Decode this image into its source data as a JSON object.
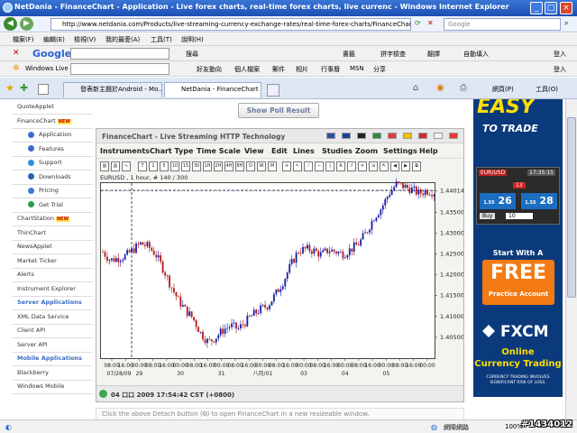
{
  "window": {
    "title": "NetDania - FinanceChart - Application - Live forex charts, real-time forex charts, live currenc - Windows Internet Explorer"
  },
  "address_bar": {
    "url": "http://www.netdania.com/Products/live-streaming-currency-exchange-rates/real-time-forex-charts/FinanceChart.aspx",
    "search_placeholder": "Google"
  },
  "menu_bar": [
    "檔案(F)",
    "編輯(E)",
    "檢視(V)",
    "我的最愛(A)",
    "工具(T)",
    "說明(H)"
  ],
  "google_bar": {
    "logo": "Google",
    "search_label": "搜尋",
    "items": [
      "書籤",
      "拼字檢查",
      "翻譯",
      "自動填入"
    ],
    "login": "登入"
  },
  "live_bar": {
    "brand": "Windows Live",
    "items": [
      "好友動向",
      "個人檔案",
      "郵件",
      "相片",
      "行事曆",
      "MSN",
      "分享"
    ],
    "login": "登入"
  },
  "tabs": [
    {
      "label": "發表新主題於Android - Mo..."
    },
    {
      "label": "NetDania - FinanceChart - ..."
    }
  ],
  "ie_toolbar": {
    "page": "網頁(P)",
    "tools": "工具(O)"
  },
  "left_nav": {
    "items": [
      {
        "label": "QuoteApplet",
        "kind": "top"
      },
      {
        "label": "FinanceChart",
        "kind": "top",
        "badge": "NEW"
      },
      {
        "label": "Application",
        "kind": "sub",
        "icon": "application-icon"
      },
      {
        "label": "Features",
        "kind": "sub",
        "icon": "features-icon"
      },
      {
        "label": "Support",
        "kind": "sub",
        "icon": "support-icon"
      },
      {
        "label": "Downloads",
        "kind": "sub",
        "icon": "downloads-icon"
      },
      {
        "label": "Pricing",
        "kind": "sub",
        "icon": "pricing-icon"
      },
      {
        "label": "Get Trial",
        "kind": "sub",
        "icon": "trial-icon"
      },
      {
        "label": "ChartStation",
        "kind": "top",
        "badge": "NEW"
      },
      {
        "label": "ThinChart",
        "kind": "top"
      },
      {
        "label": "NewsApplet",
        "kind": "top"
      },
      {
        "label": "Market Ticker",
        "kind": "top"
      },
      {
        "label": "Alerts",
        "kind": "top"
      },
      {
        "label": "Instrument Explorer",
        "kind": "top"
      },
      {
        "label": "Server Applications",
        "kind": "header"
      },
      {
        "label": "XML Data Service",
        "kind": "top"
      },
      {
        "label": "Client API",
        "kind": "top"
      },
      {
        "label": "Server API",
        "kind": "top"
      },
      {
        "label": "Mobile Applications",
        "kind": "header"
      },
      {
        "label": "Blackberry",
        "kind": "top"
      },
      {
        "label": "Windows Mobile",
        "kind": "top"
      }
    ]
  },
  "poll_button": "Show Poll Result",
  "finance_chart": {
    "title": "FinanceChart - Live Streaming HTTP Technology",
    "menu": [
      "Instruments",
      "Chart Type",
      "Time Scale",
      "View",
      "Edit",
      "Lines",
      "Studies",
      "Zoom",
      "Settings",
      "Help"
    ],
    "timeframes": [
      "T",
      "1",
      "5",
      "10",
      "15",
      "30",
      "1H",
      "2H",
      "4H",
      "8H",
      "D",
      "W",
      "M"
    ],
    "symbol_line": "EURUSD , 1 hour, # 140 / 300",
    "status": "04 口口 2009 17:54:42  CST (+0800)",
    "colors": {
      "up": "#1a1aa8",
      "down": "#b01818",
      "grid": "#333333"
    }
  },
  "chart_data": {
    "type": "candlestick",
    "symbol": "EURUSD",
    "interval": "1 hour",
    "ylim": [
      1.4,
      1.442
    ],
    "yticks": [
      1.405,
      1.41,
      1.415,
      1.42,
      1.425,
      1.43,
      1.435,
      1.44014
    ],
    "ytick_labels": [
      "1.40500",
      "1.41000",
      "1.41500",
      "1.42000",
      "1.42500",
      "1.43000",
      "1.43500",
      "1.44014"
    ],
    "time_labels": [
      "08:00",
      "16:00",
      "00:00",
      "08:00",
      "16:00",
      "00:00",
      "08:00",
      "16:00",
      "00:00",
      "08:00",
      "16:00",
      "00:00",
      "08:00",
      "16:00",
      "00:00",
      "08:00",
      "16:00",
      "00:00",
      "08:00",
      "16:00",
      "00:00",
      "08:00",
      "16:00",
      "00:00"
    ],
    "date_labels": [
      "07/28/09",
      "29",
      "30",
      "31",
      "八月/01",
      "03",
      "04",
      "05"
    ],
    "last_price": 1.44014,
    "close_path": [
      1.4255,
      1.4235,
      1.424,
      1.4245,
      1.426,
      1.4275,
      1.4268,
      1.425,
      1.4215,
      1.4175,
      1.414,
      1.4115,
      1.4095,
      1.406,
      1.4038,
      1.405,
      1.4068,
      1.4078,
      1.407,
      1.4088,
      1.4105,
      1.4118,
      1.4128,
      1.4155,
      1.4185,
      1.4225,
      1.4258,
      1.4262,
      1.4258,
      1.4248,
      1.426,
      1.4255,
      1.425,
      1.4262,
      1.4275,
      1.4302,
      1.4338,
      1.436,
      1.4395,
      1.4418,
      1.4412,
      1.4405,
      1.4395,
      1.4402,
      1.4398
    ]
  },
  "note": "Click the above Detach button (⧉) to open FinanceChart in a new resizeable window.",
  "ad": {
    "easy": "EASY",
    "to_trade": "TO TRADE",
    "pair": "EUR/USD",
    "time": "17:35:15",
    "sell": "26",
    "sell_prefix": "1.55",
    "buy": "28",
    "buy_prefix": "1.55",
    "amount": "10",
    "action": "Buy",
    "start_with": "Start With A",
    "free": "FREE",
    "practice": "Practice Account",
    "brand": "FXCM",
    "online": "Online",
    "currency_trading": "Currency Trading",
    "warning": "CURRENCY TRADING INVOLVES SIGNIFICANT RISK OF LOSS."
  },
  "status_bar": {
    "zone": "網際網路",
    "zoom": "100%"
  },
  "watermark": "#1434012"
}
